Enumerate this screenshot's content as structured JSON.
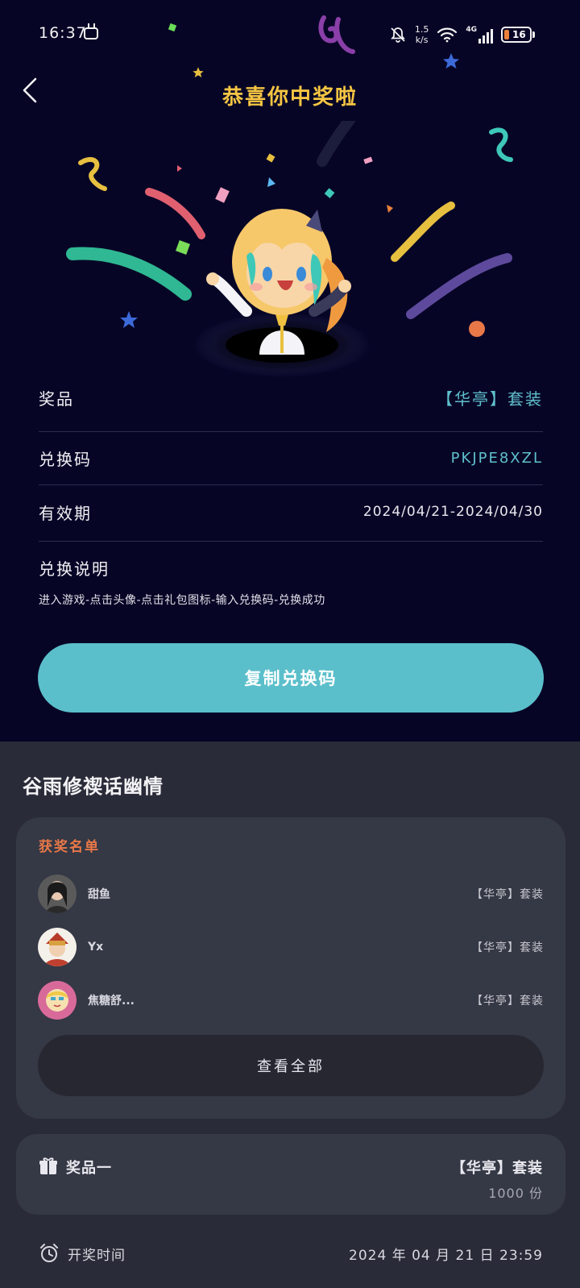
{
  "status_bar": {
    "time": "16:37",
    "speed_value": "1.5",
    "speed_unit": "k/s",
    "network": "4G",
    "battery": "16"
  },
  "header": {
    "title": "恭喜你中奖啦"
  },
  "details": {
    "prize_label": "奖品",
    "prize_value": "【华亭】套装",
    "code_label": "兑换码",
    "code_value": "PKJPE8XZL",
    "validity_label": "有效期",
    "validity_value": "2024/04/21-2024/04/30",
    "instructions_label": "兑换说明",
    "instructions_text": "进入游戏-点击头像-点击礼包图标-输入兑换码-兑换成功"
  },
  "copy_button_label": "复制兑换码",
  "event_title": "谷雨修禊话幽情",
  "winners": {
    "title": "获奖名单",
    "items": [
      {
        "name": "甜鱼",
        "prize": "【华亭】套装"
      },
      {
        "name": "Yx",
        "prize": "【华亭】套装"
      },
      {
        "name": "焦糖舒...",
        "prize": "【华亭】套装"
      }
    ],
    "view_all_label": "查看全部"
  },
  "prize_card": {
    "label": "奖品一",
    "name": "【华亭】套装",
    "count": "1000 份"
  },
  "draw": {
    "label": "开奖时间",
    "time": "2024 年 04 月 21 日 23:59"
  },
  "colors": {
    "accent": "#5bbfcb",
    "title_gold": "#f5c542",
    "winners_orange": "#e87848",
    "top_bg": "#070526",
    "bottom_bg": "#2a2b38"
  }
}
